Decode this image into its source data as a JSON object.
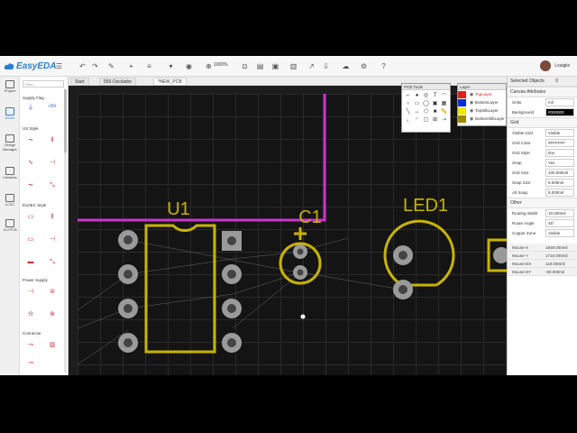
{
  "app": {
    "name": "EasyEDA",
    "user": "Lsuigiis"
  },
  "toolbar": {
    "zoom": "1000%"
  },
  "leftnav": [
    {
      "id": "project",
      "label": "Project"
    },
    {
      "id": "eelib",
      "label": "EELib"
    },
    {
      "id": "design-manager",
      "label": "Design Manager"
    },
    {
      "id": "libraries",
      "label": "Libraries"
    },
    {
      "id": "lcsc",
      "label": "LCSC"
    },
    {
      "id": "jlcpcb",
      "label": "JLCPCB"
    }
  ],
  "library": {
    "filter_placeholder": "Filter",
    "categories": [
      "Supply Flag",
      "US Style",
      "EU/IEC Style",
      "Power Supply",
      "Connector"
    ],
    "supply_labels": {
      "plus5v": "+5V"
    }
  },
  "tabs": [
    {
      "label": "Start",
      "active": false
    },
    {
      "label": "555-Oscilador",
      "active": false
    },
    {
      "label": "*NEW_PCB",
      "active": true
    }
  ],
  "canvas": {
    "designators": {
      "u1": "U1",
      "c1": "C1",
      "led1": "LED1"
    },
    "colors": {
      "track": "#cc33cc",
      "silk": "#c8b400",
      "pad": "#9a9a9a",
      "background": "#141414"
    }
  },
  "pcb_tools": {
    "title": "PCB Tools"
  },
  "layers": {
    "title": "Layer",
    "items": [
      {
        "name": "TopLayer",
        "color": "#e0201e",
        "active": true
      },
      {
        "name": "BottomLayer",
        "color": "#0a2bd6",
        "active": false
      },
      {
        "name": "TopSilkLayer",
        "color": "#f2e600",
        "active": false
      },
      {
        "name": "BottomSilkLayer",
        "color": "#9a8a00",
        "active": false
      }
    ]
  },
  "properties": {
    "selected_objects_label": "Selected Objects",
    "selected_count": "0",
    "canvas_attributes": "Canvas Attributes",
    "units_label": "Units",
    "units_value": "mil",
    "background_label": "Background",
    "background_value": "#000000",
    "grid_section": "Grid",
    "rows": [
      {
        "label": "Visible Grid",
        "value": "Visible"
      },
      {
        "label": "Grid Color",
        "value": "#FFFFFF"
      },
      {
        "label": "Grid Style",
        "value": "line"
      },
      {
        "label": "Snap",
        "value": "Yes"
      },
      {
        "label": "Grid Size",
        "value": "100.000mil"
      },
      {
        "label": "Snap Size",
        "value": "5.000mil"
      },
      {
        "label": "Alt Snap",
        "value": "5.000mil"
      }
    ],
    "other_section": "Other",
    "other_rows": [
      {
        "label": "Routing Width",
        "value": "10.000mil"
      },
      {
        "label": "Route Angle",
        "value": "45°"
      },
      {
        "label": "Copper Zone",
        "value": "Visible"
      }
    ],
    "readouts": [
      {
        "label": "Mouse-X",
        "value": "1939.000mil"
      },
      {
        "label": "Mouse-Y",
        "value": "1718.000mil"
      },
      {
        "label": "Mouse-DX",
        "value": "119.000mil"
      },
      {
        "label": "Mouse-DY",
        "value": "-60.000mil"
      }
    ]
  }
}
